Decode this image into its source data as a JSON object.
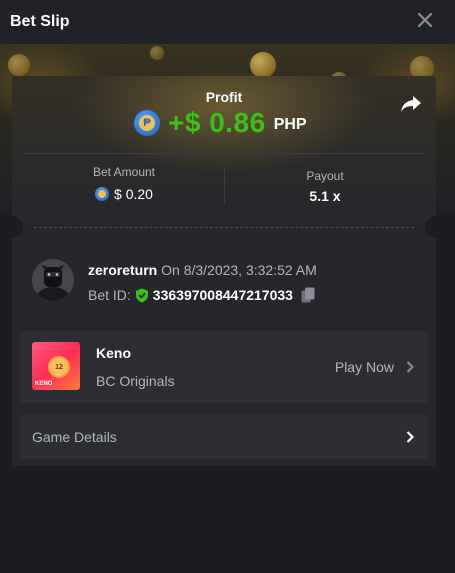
{
  "window": {
    "title": "Bet Slip",
    "close_icon": "close-icon"
  },
  "profit": {
    "label": "Profit",
    "value": "+$ 0.86",
    "currency": "PHP",
    "currency_icon": "php-coin-icon",
    "share_icon": "share-icon"
  },
  "stats": {
    "bet_amount_label": "Bet Amount",
    "bet_amount_value": "$ 0.20",
    "payout_label": "Payout",
    "payout_value": "5.1 x"
  },
  "user": {
    "name": "zeroreturn",
    "date": "On 8/3/2023, 3:32:52 AM",
    "bet_id_label": "Bet ID:",
    "bet_id": "336397008447217033",
    "verified_icon": "shield-check-icon",
    "copy_icon": "copy-icon"
  },
  "game": {
    "name": "Keno",
    "provider": "BC Originals",
    "play_label": "Play Now",
    "thumb_label": "KENO",
    "thumb_number": "12"
  },
  "details": {
    "label": "Game Details"
  },
  "colors": {
    "profit": "#3bc117",
    "bg": "#1c1d21",
    "card": "#25272c",
    "row": "#2c2e34"
  }
}
